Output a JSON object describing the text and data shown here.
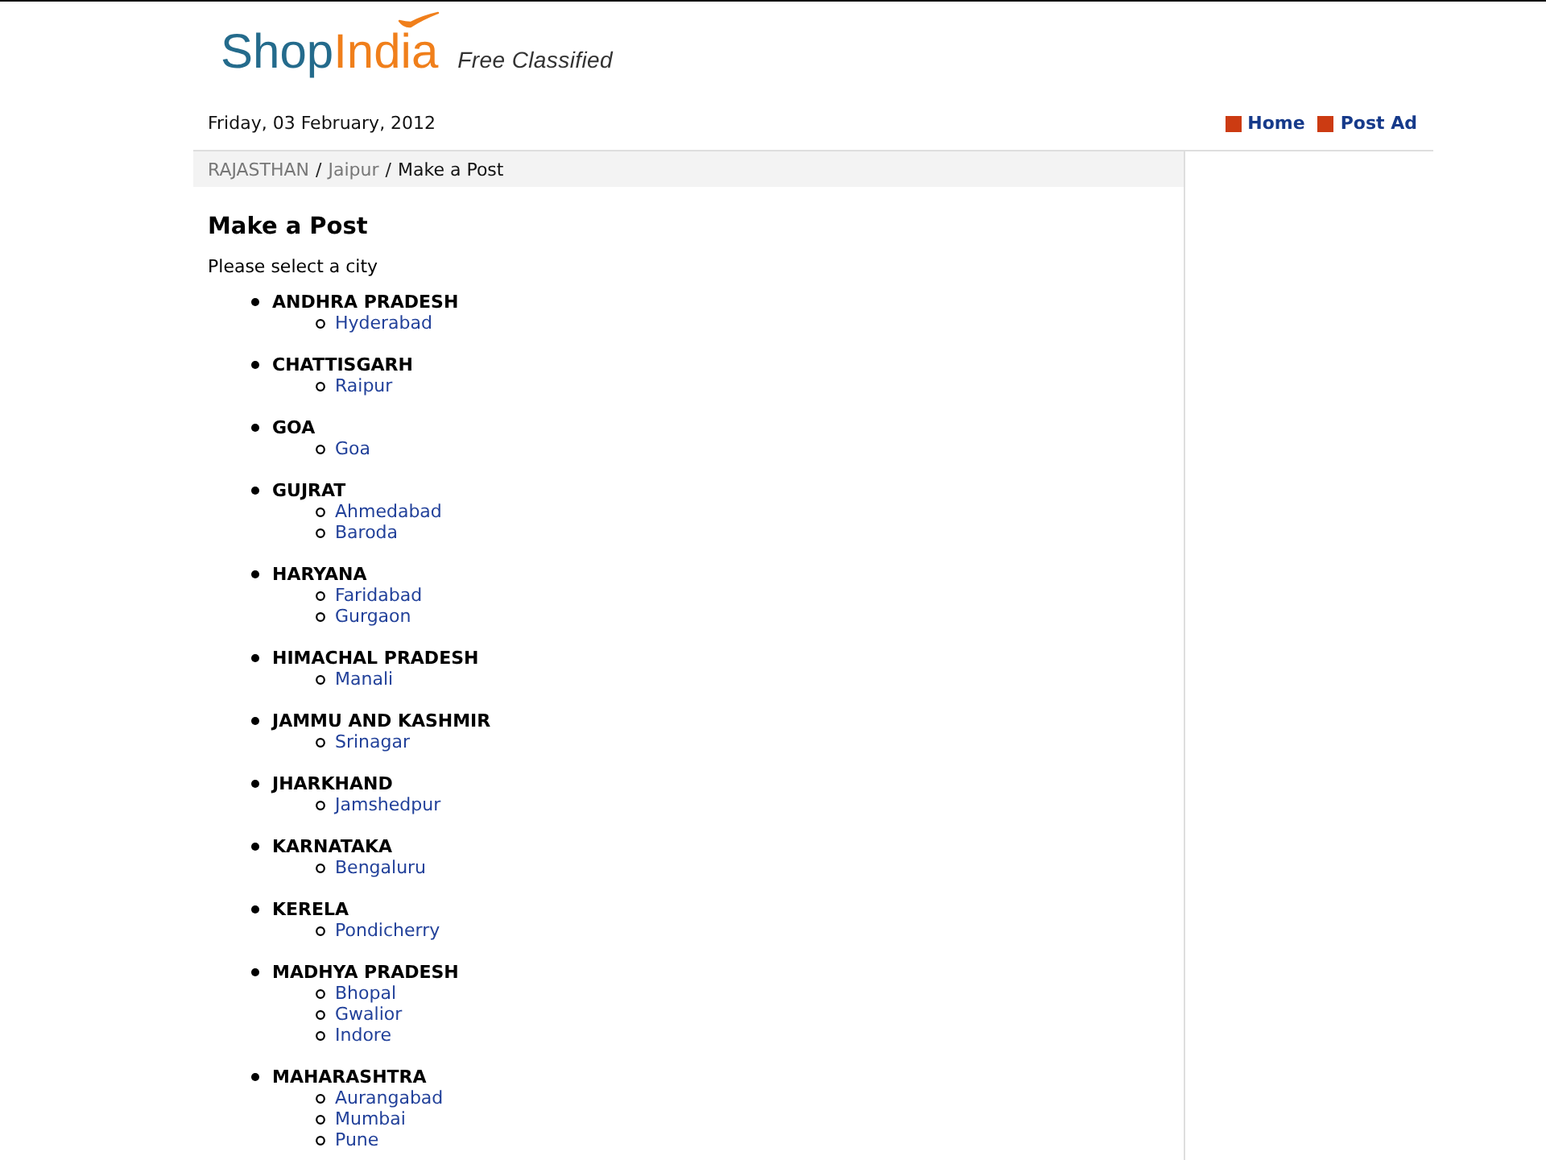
{
  "logo": {
    "words": [
      "Shop",
      "India"
    ],
    "tagline": "Free Classified"
  },
  "date": "Friday, 03 February, 2012",
  "nav": [
    {
      "label": "Home"
    },
    {
      "label": "Post Ad"
    }
  ],
  "breadcrumb": [
    {
      "label": "RAJASTHAN",
      "kind": "link"
    },
    {
      "label": "/",
      "kind": "separator"
    },
    {
      "label": "Jaipur",
      "kind": "link"
    },
    {
      "label": "/",
      "kind": "separator"
    },
    {
      "label": "Make a Post",
      "kind": "current"
    }
  ],
  "heading": "Make a Post",
  "instruction": "Please select a city",
  "states": [
    {
      "name": "ANDHRA PRADESH",
      "cities": [
        "Hyderabad"
      ]
    },
    {
      "name": "CHATTISGARH",
      "cities": [
        "Raipur"
      ]
    },
    {
      "name": "GOA",
      "cities": [
        "Goa"
      ]
    },
    {
      "name": "GUJRAT",
      "cities": [
        "Ahmedabad",
        "Baroda"
      ]
    },
    {
      "name": "HARYANA",
      "cities": [
        "Faridabad",
        "Gurgaon"
      ]
    },
    {
      "name": "HIMACHAL PRADESH",
      "cities": [
        "Manali"
      ]
    },
    {
      "name": "JAMMU AND KASHMIR",
      "cities": [
        "Srinagar"
      ]
    },
    {
      "name": "JHARKHAND",
      "cities": [
        "Jamshedpur"
      ]
    },
    {
      "name": "KARNATAKA",
      "cities": [
        "Bengaluru"
      ]
    },
    {
      "name": "KERELA",
      "cities": [
        "Pondicherry"
      ]
    },
    {
      "name": "MADHYA PRADESH",
      "cities": [
        "Bhopal",
        "Gwalior",
        "Indore"
      ]
    },
    {
      "name": "MAHARASHTRA",
      "cities": [
        "Aurangabad",
        "Mumbai",
        "Pune"
      ]
    }
  ]
}
